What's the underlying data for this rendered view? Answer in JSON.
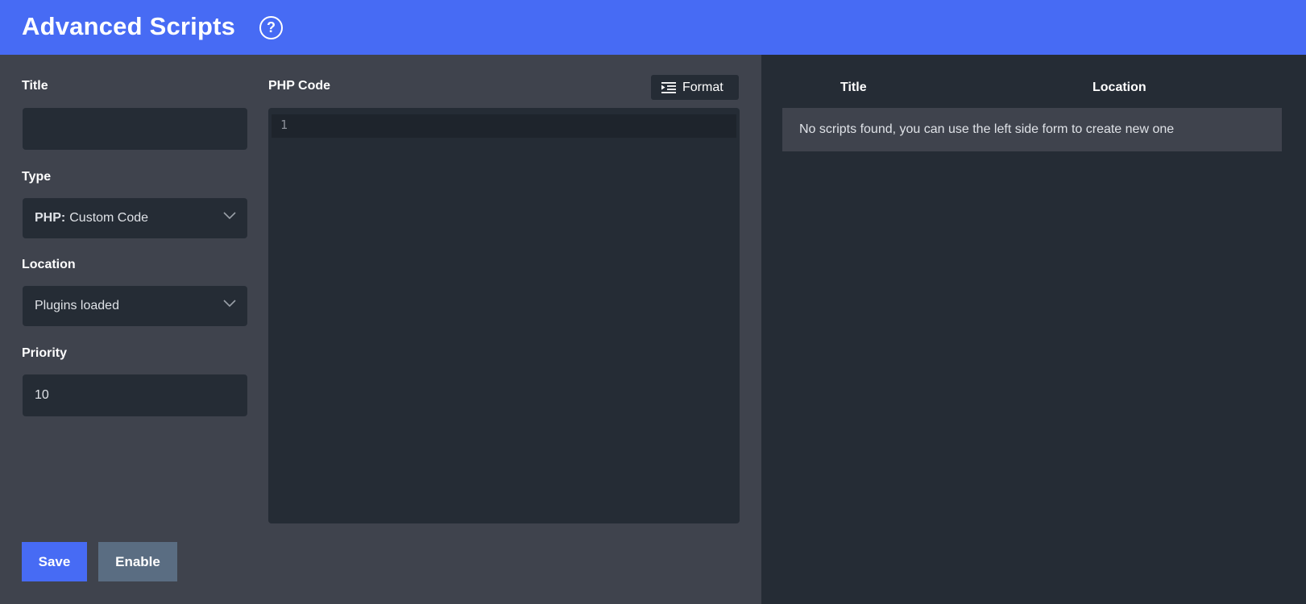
{
  "header": {
    "title": "Advanced Scripts",
    "help_symbol": "?"
  },
  "form": {
    "title_label": "Title",
    "title_value": "",
    "type_label": "Type",
    "type_prefix": "PHP:",
    "type_value": "Custom Code",
    "location_label": "Location",
    "location_value": "Plugins loaded",
    "priority_label": "Priority",
    "priority_value": "10"
  },
  "editor": {
    "label": "PHP Code",
    "format_label": "Format",
    "line_number": "1"
  },
  "actions": {
    "save_label": "Save",
    "enable_label": "Enable"
  },
  "scripts_table": {
    "columns": [
      "Title",
      "Location"
    ],
    "empty_message": "No scripts found, you can use the left side form to create new one"
  },
  "colors": {
    "accent": "#476bf4",
    "panel_dark": "#252c35",
    "panel_mid": "#3f434d",
    "enable_button": "#5a6d82"
  },
  "icons": {
    "help": "question-circle-icon",
    "format": "indent-lines-icon",
    "dropdown": "chevron-down-icon"
  }
}
